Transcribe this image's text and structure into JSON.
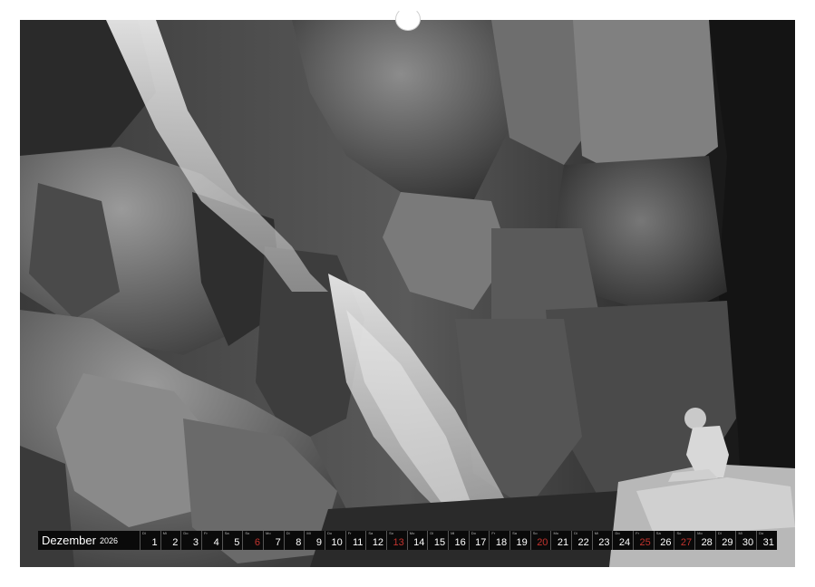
{
  "calendar": {
    "month": "Dezember",
    "year": "2026",
    "days": [
      {
        "n": "1",
        "wd": "Di",
        "sun": false
      },
      {
        "n": "2",
        "wd": "Mi",
        "sun": false
      },
      {
        "n": "3",
        "wd": "Do",
        "sun": false
      },
      {
        "n": "4",
        "wd": "Fr",
        "sun": false
      },
      {
        "n": "5",
        "wd": "Sa",
        "sun": false
      },
      {
        "n": "6",
        "wd": "So",
        "sun": true
      },
      {
        "n": "7",
        "wd": "Mo",
        "sun": false
      },
      {
        "n": "8",
        "wd": "Di",
        "sun": false
      },
      {
        "n": "9",
        "wd": "Mi",
        "sun": false
      },
      {
        "n": "10",
        "wd": "Do",
        "sun": false
      },
      {
        "n": "11",
        "wd": "Fr",
        "sun": false
      },
      {
        "n": "12",
        "wd": "Sa",
        "sun": false
      },
      {
        "n": "13",
        "wd": "So",
        "sun": true
      },
      {
        "n": "14",
        "wd": "Mo",
        "sun": false
      },
      {
        "n": "15",
        "wd": "Di",
        "sun": false
      },
      {
        "n": "16",
        "wd": "Mi",
        "sun": false
      },
      {
        "n": "17",
        "wd": "Do",
        "sun": false
      },
      {
        "n": "18",
        "wd": "Fr",
        "sun": false
      },
      {
        "n": "19",
        "wd": "Sa",
        "sun": false
      },
      {
        "n": "20",
        "wd": "So",
        "sun": true
      },
      {
        "n": "21",
        "wd": "Mo",
        "sun": false
      },
      {
        "n": "22",
        "wd": "Di",
        "sun": false
      },
      {
        "n": "23",
        "wd": "Mi",
        "sun": false
      },
      {
        "n": "24",
        "wd": "Do",
        "sun": false
      },
      {
        "n": "25",
        "wd": "Fr",
        "sun": true
      },
      {
        "n": "26",
        "wd": "Sa",
        "sun": false
      },
      {
        "n": "27",
        "wd": "So",
        "sun": true
      },
      {
        "n": "28",
        "wd": "Mo",
        "sun": false
      },
      {
        "n": "29",
        "wd": "Di",
        "sun": false
      },
      {
        "n": "30",
        "wd": "Mi",
        "sun": false
      },
      {
        "n": "31",
        "wd": "Do",
        "sun": false
      }
    ]
  },
  "colors": {
    "bar_background": "#0a0a0a",
    "holiday_red": "#c2332e",
    "binding_hole": "#d9d9d9"
  }
}
